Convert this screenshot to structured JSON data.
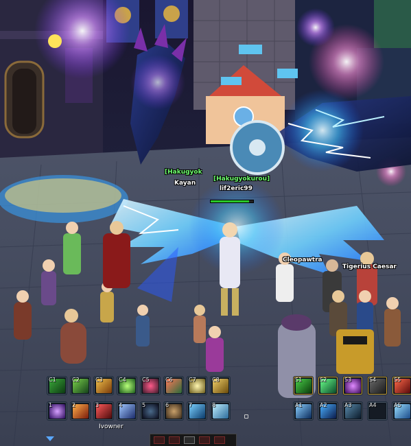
{
  "nameplates": [
    {
      "text": "[Hakugyok",
      "color": "green"
    },
    {
      "text": "Kayan",
      "color": "white"
    },
    {
      "text": "[Hakugyokurou]",
      "color": "green"
    },
    {
      "text": "lif2eric99",
      "color": "white"
    },
    {
      "text": "Cleopawtra",
      "color": "white"
    },
    {
      "text": "Tigerius Caesar",
      "color": "white"
    },
    {
      "text": "Ivowner",
      "color": "white"
    }
  ],
  "skillbar_left": {
    "row1": [
      "C1",
      "C2",
      "C3",
      "C4",
      "C5",
      "C6",
      "C7",
      "C8"
    ],
    "row2": [
      "1",
      "2",
      "3",
      "4",
      "5",
      "6",
      "7",
      "8"
    ]
  },
  "skillbar_right": {
    "row1": [
      "S1",
      "S2",
      "S3",
      "S4",
      "S5"
    ],
    "row2": [
      "A1",
      "A2",
      "A3",
      "A4",
      "A5"
    ]
  },
  "colors": {
    "nameplate_green": "#6eff6e",
    "nameplate_white": "#ffffff",
    "hp_green": "#28c828",
    "slot_border": "#44505e"
  }
}
